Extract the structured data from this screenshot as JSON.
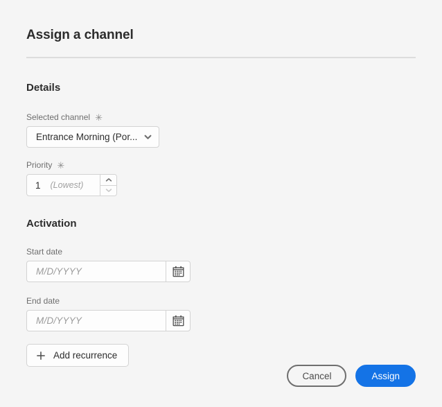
{
  "dialog": {
    "title": "Assign a channel"
  },
  "details": {
    "heading": "Details",
    "selected_channel": {
      "label": "Selected channel",
      "required_marker": "✳",
      "value": "Entrance Morning (Por...",
      "chevron_icon": "chevron-down-icon"
    },
    "priority": {
      "label": "Priority",
      "required_marker": "✳",
      "value": "1",
      "hint": "(Lowest)",
      "increment_icon": "chevron-up-icon",
      "decrement_icon": "chevron-down-icon"
    }
  },
  "activation": {
    "heading": "Activation",
    "start_date": {
      "label": "Start date",
      "value": "",
      "placeholder": "M/D/YYYY",
      "calendar_icon": "calendar-icon"
    },
    "end_date": {
      "label": "End date",
      "value": "",
      "placeholder": "M/D/YYYY",
      "calendar_icon": "calendar-icon"
    },
    "add_recurrence": {
      "label": "Add recurrence",
      "icon": "plus-icon"
    }
  },
  "footer": {
    "cancel_label": "Cancel",
    "assign_label": "Assign"
  },
  "colors": {
    "accent": "#1473E6",
    "page_background": "#F5F5F5",
    "field_background": "#FDFDFD",
    "border": "#D3D3D3",
    "text_primary": "#2C2C2C",
    "text_secondary": "#6E6E6E",
    "placeholder": "#9B9B9B",
    "divider": "#DCDCDC"
  }
}
